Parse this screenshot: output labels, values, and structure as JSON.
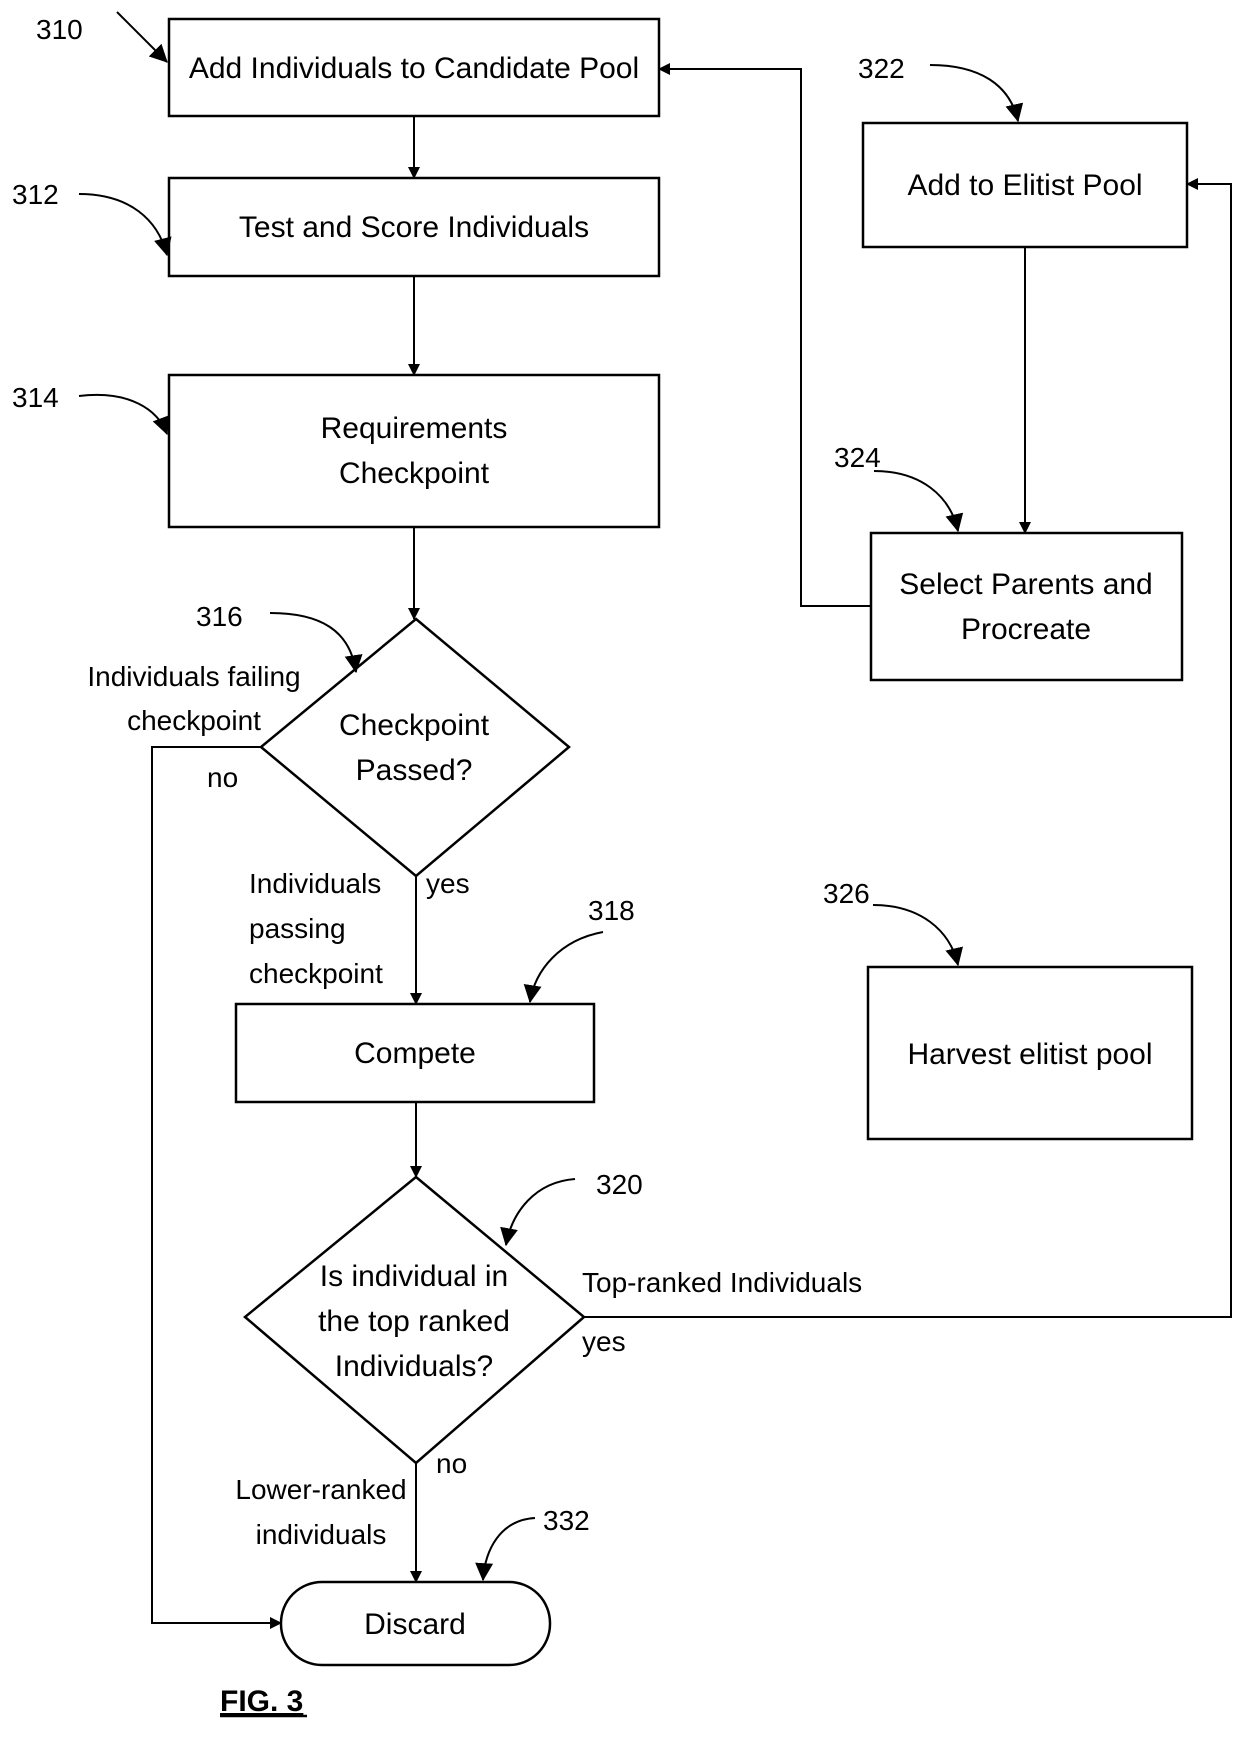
{
  "figure": {
    "caption": "FIG. 3",
    "nodes": [
      {
        "id": "310",
        "ref": "310",
        "type": "process",
        "lines": [
          "Add Individuals to Candidate Pool"
        ]
      },
      {
        "id": "312",
        "ref": "312",
        "type": "process",
        "lines": [
          "Test and Score Individuals"
        ]
      },
      {
        "id": "314",
        "ref": "314",
        "type": "process",
        "lines": [
          "Requirements",
          "Checkpoint"
        ]
      },
      {
        "id": "316",
        "ref": "316",
        "type": "decision",
        "lines": [
          "Checkpoint",
          "Passed?"
        ]
      },
      {
        "id": "318",
        "ref": "318",
        "type": "process",
        "lines": [
          "Compete"
        ]
      },
      {
        "id": "320",
        "ref": "320",
        "type": "decision",
        "lines": [
          "Is individual in",
          "the top ranked",
          "Individuals?"
        ]
      },
      {
        "id": "322",
        "ref": "322",
        "type": "process",
        "lines": [
          "Add to Elitist Pool"
        ]
      },
      {
        "id": "324",
        "ref": "324",
        "type": "process",
        "lines": [
          "Select Parents and",
          "Procreate"
        ]
      },
      {
        "id": "326",
        "ref": "326",
        "type": "process",
        "lines": [
          "Harvest elitist pool"
        ]
      },
      {
        "id": "332",
        "ref": "332",
        "type": "terminal",
        "lines": [
          "Discard"
        ]
      }
    ],
    "edges": [
      {
        "from": "310",
        "to": "312"
      },
      {
        "from": "312",
        "to": "314"
      },
      {
        "from": "314",
        "to": "316"
      },
      {
        "from": "316",
        "to": "318",
        "branch": "yes",
        "label": [
          "Individuals",
          "passing",
          "checkpoint"
        ]
      },
      {
        "from": "316",
        "to": "332",
        "branch": "no",
        "label": [
          "Individuals failing",
          "checkpoint"
        ]
      },
      {
        "from": "318",
        "to": "320"
      },
      {
        "from": "320",
        "to": "322",
        "branch": "yes",
        "label": [
          "Top-ranked Individuals"
        ]
      },
      {
        "from": "320",
        "to": "332",
        "branch": "no",
        "label": [
          "Lower-ranked",
          "individuals"
        ]
      },
      {
        "from": "322",
        "to": "324"
      },
      {
        "from": "324",
        "to": "310"
      }
    ],
    "branch_words": {
      "yes": "yes",
      "no": "no"
    }
  }
}
